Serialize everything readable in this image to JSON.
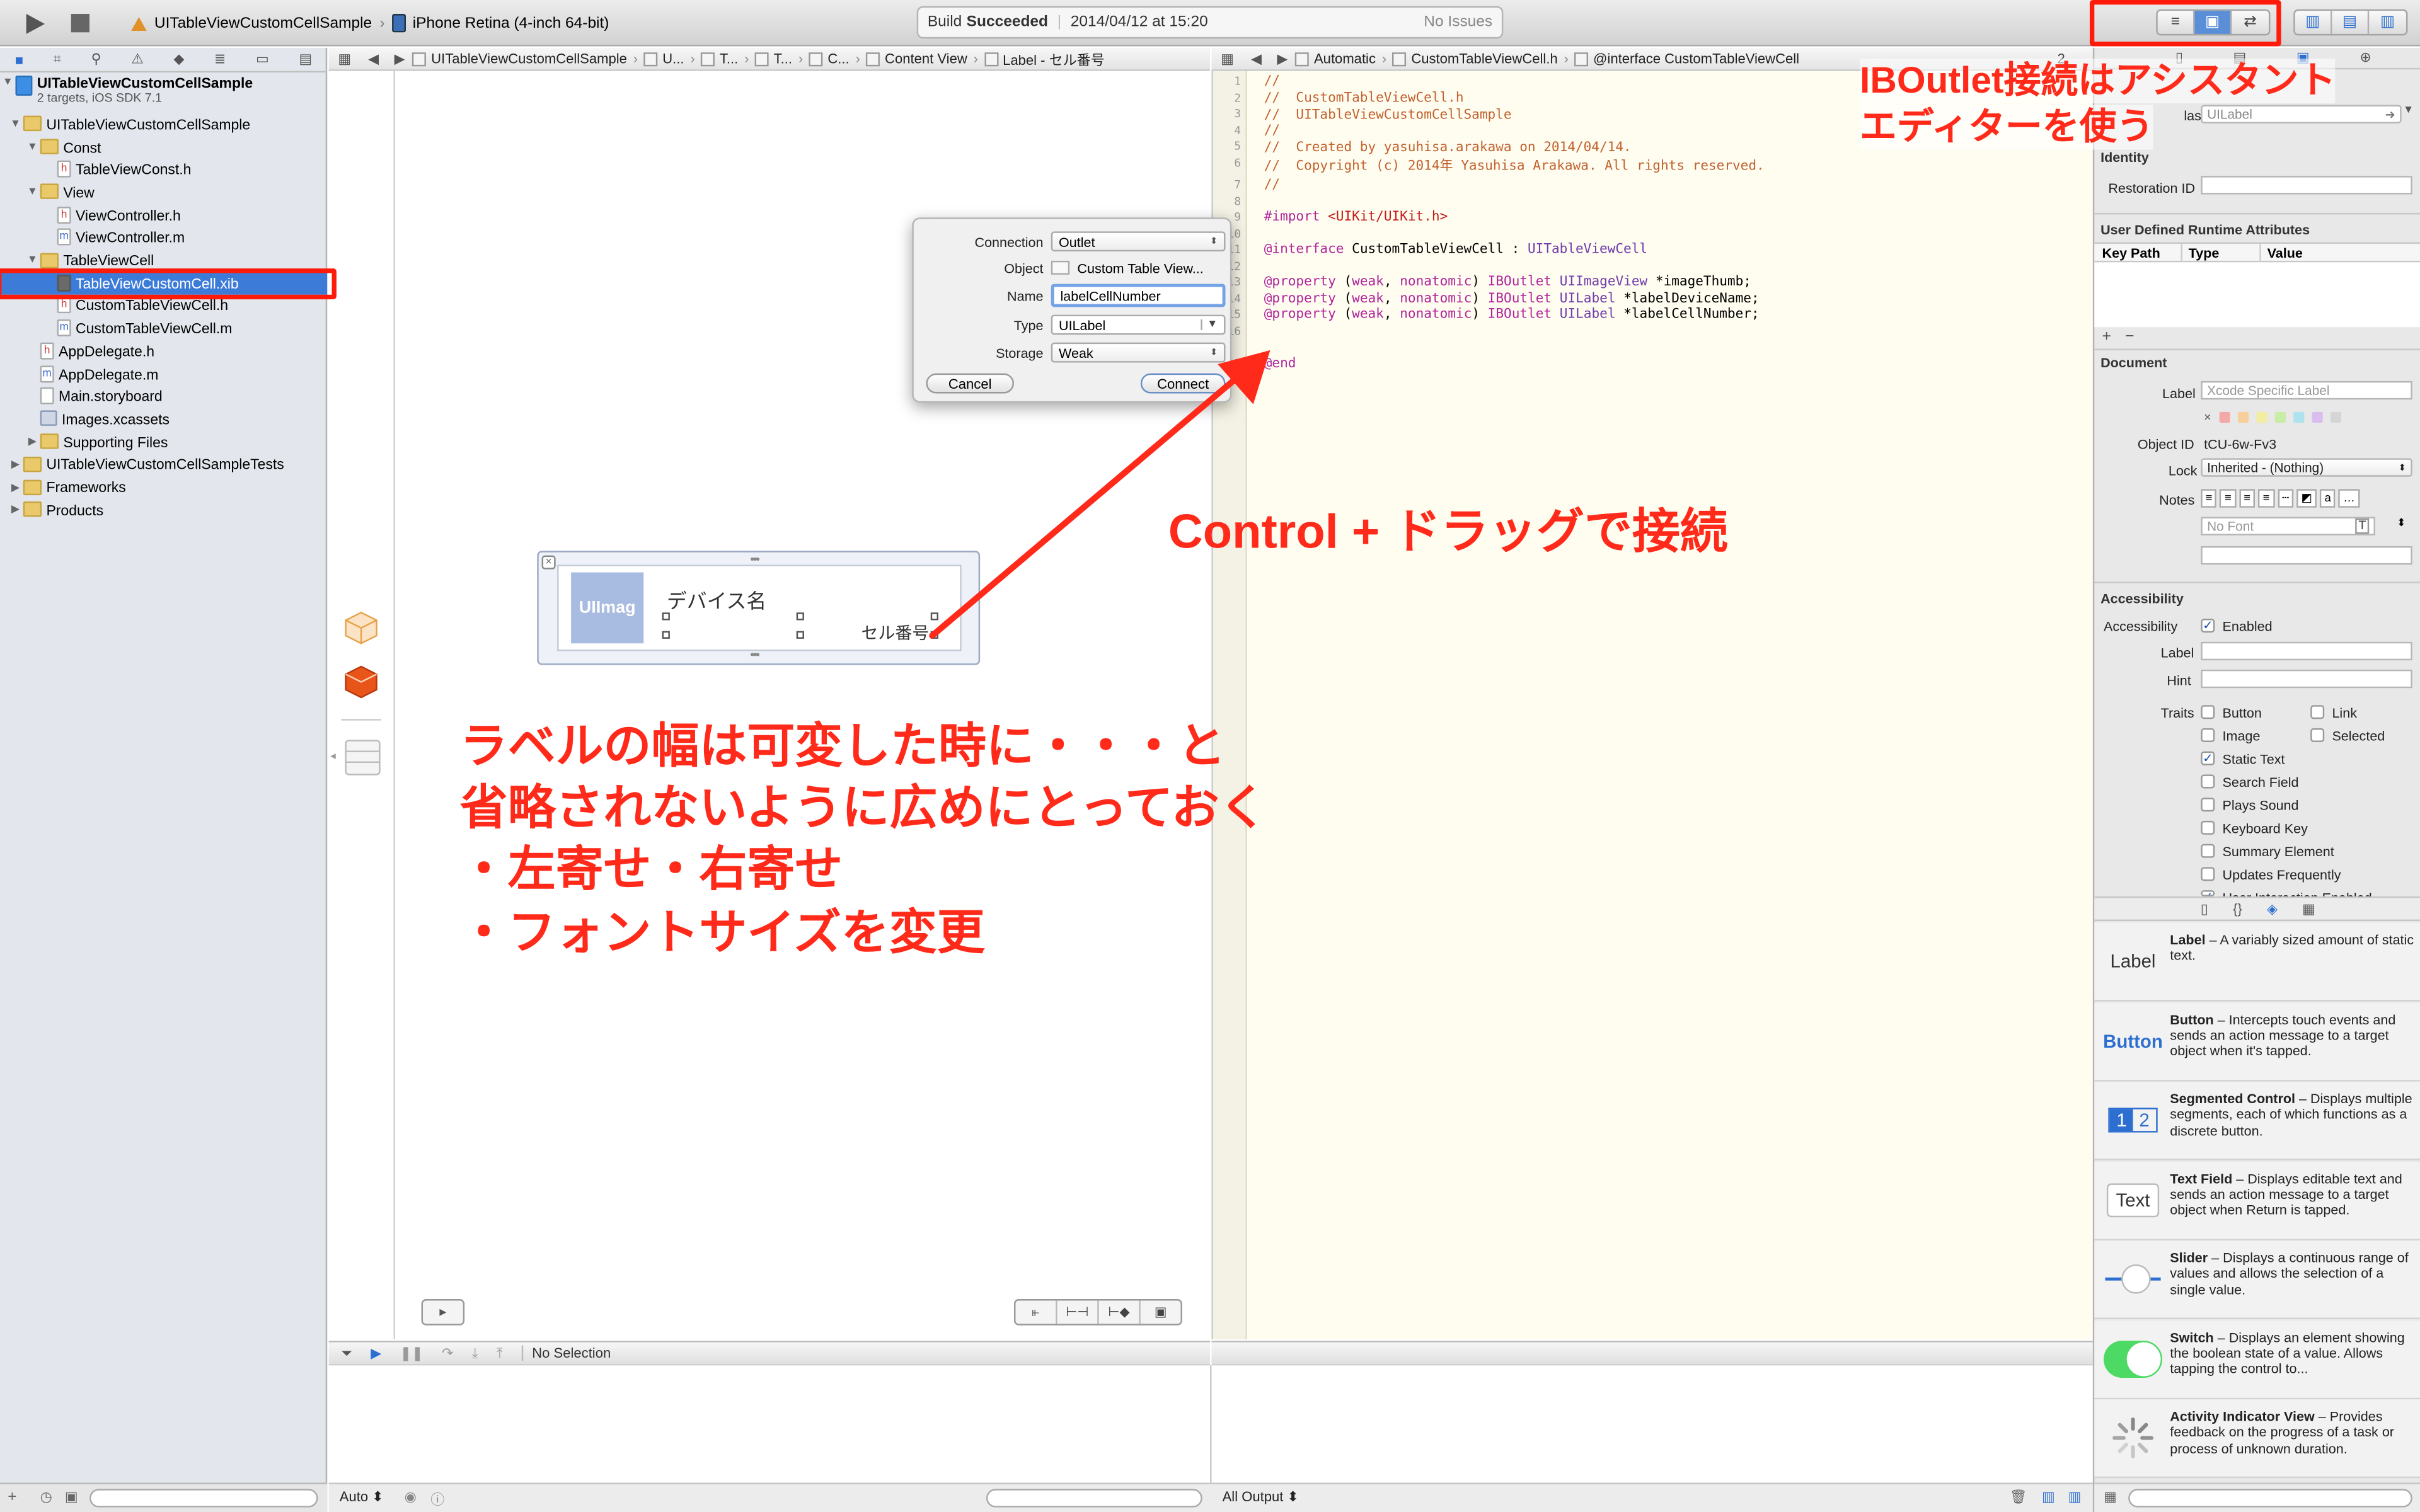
{
  "toolbar": {
    "scheme": "UITableViewCustomCellSample",
    "device": "iPhone Retina (4-inch 64-bit)",
    "status_prefix": "Build",
    "status_word": "Succeeded",
    "status_date": "2014/04/12 at 15:20",
    "issues": "No Issues"
  },
  "navigator": {
    "project_name": "UITableViewCustomCellSample",
    "project_sub": "2 targets, iOS SDK 7.1",
    "items": [
      {
        "label": "UITableViewCustomCellSample",
        "kind": "folder"
      },
      {
        "label": "Const",
        "kind": "folder"
      },
      {
        "label": "TableViewConst.h",
        "kind": "h"
      },
      {
        "label": "View",
        "kind": "folder"
      },
      {
        "label": "ViewController.h",
        "kind": "h"
      },
      {
        "label": "ViewController.m",
        "kind": "m"
      },
      {
        "label": "TableViewCell",
        "kind": "folder"
      },
      {
        "label": "TableViewCustomCell.xib",
        "kind": "xib",
        "selected": true
      },
      {
        "label": "CustomTableViewCell.h",
        "kind": "h"
      },
      {
        "label": "CustomTableViewCell.m",
        "kind": "m"
      },
      {
        "label": "AppDelegate.h",
        "kind": "h"
      },
      {
        "label": "AppDelegate.m",
        "kind": "m"
      },
      {
        "label": "Main.storyboard",
        "kind": "storyboard"
      },
      {
        "label": "Images.xcassets",
        "kind": "assets"
      },
      {
        "label": "Supporting Files",
        "kind": "folder"
      },
      {
        "label": "UITableViewCustomCellSampleTests",
        "kind": "folder"
      },
      {
        "label": "Frameworks",
        "kind": "folder"
      },
      {
        "label": "Products",
        "kind": "folder"
      }
    ]
  },
  "jumpbar_left": [
    "UITableViewCustomCellSample",
    "U...",
    "T...",
    "T...",
    "C...",
    "Content View",
    "Label - セル番号"
  ],
  "jumpbar_right": [
    "Automatic",
    "CustomTableViewCell.h",
    "@interface CustomTableViewCell"
  ],
  "jumpbar_right_count": "2",
  "code": {
    "l1": "//",
    "l2": "//  CustomTableViewCell.h",
    "l3": "//  UITableViewCustomCellSample",
    "l4": "//",
    "l5": "//  Created by yasuhisa.arakawa on 2014/04/14.",
    "l6": "//  Copyright (c) 2014年 Yasuhisa Arakawa. All rights reserved.",
    "l7": "//",
    "import_kw": "#import",
    "import_path": "<UIKit/UIKit.h>",
    "iface_kw": "@interface",
    "iface_name": "CustomTableViewCell :",
    "iface_super": "UITableViewCell",
    "prop1_a": "@property",
    "prop1_b": "(weak, nonatomic)",
    "prop1_c": "IBOutlet",
    "prop1_d": "UIImageView",
    "prop1_e": "*imageThumb;",
    "prop2_a": "@property",
    "prop2_b": "(weak, nonatomic)",
    "prop2_c": "IBOutlet",
    "prop2_d": "UILabel",
    "prop2_e": "*labelDeviceName;",
    "prop3_a": "@property",
    "prop3_b": "(weak, nonatomic)",
    "prop3_c": "IBOutlet",
    "prop3_d": "UILabel",
    "prop3_e": "*labelCellNumber;",
    "end": "@end",
    "line_numbers": [
      "1",
      "2",
      "3",
      "4",
      "5",
      "6",
      "7",
      "8",
      "9",
      "10",
      "11",
      "12",
      "13",
      "14",
      "15",
      "16",
      "17"
    ]
  },
  "cell": {
    "image_label": "UIImag",
    "device_label": "デバイス名",
    "number_label": "セル番号"
  },
  "popup": {
    "connection_label": "Connection",
    "connection_value": "Outlet",
    "object_label": "Object",
    "object_value": "Custom Table View...",
    "name_label": "Name",
    "name_value": "labelCellNumber",
    "type_label": "Type",
    "type_value": "UILabel",
    "storage_label": "Storage",
    "storage_value": "Weak",
    "cancel": "Cancel",
    "connect": "Connect"
  },
  "debug": {
    "selection": "No Selection",
    "auto": "Auto",
    "output": "All Output"
  },
  "inspector": {
    "class_label": "lass",
    "class_value": "UILabel",
    "identity": "Identity",
    "restoration_id": "Restoration ID",
    "udra": "User Defined Runtime Attributes",
    "col_keypath": "Key Path",
    "col_type": "Type",
    "col_value": "Value",
    "document": "Document",
    "label_label": "Label",
    "label_placeholder": "Xcode Specific Label",
    "object_id_label": "Object ID",
    "object_id_value": "tCU-6w-Fv3",
    "lock_label": "Lock",
    "lock_value": "Inherited - (Nothing)",
    "notes_label": "Notes",
    "font_placeholder": "No Font",
    "accessibility": "Accessibility",
    "acc_label": "Accessibility",
    "acc_enabled": "Enabled",
    "acc_label2": "Label",
    "acc_hint": "Hint",
    "traits_label": "Traits",
    "traits": [
      {
        "name": "Button",
        "checked": false
      },
      {
        "name": "Link",
        "checked": false
      },
      {
        "name": "Image",
        "checked": false
      },
      {
        "name": "Selected",
        "checked": false
      },
      {
        "name": "Static Text",
        "checked": true
      },
      {
        "name": "Search Field",
        "checked": false
      },
      {
        "name": "Plays Sound",
        "checked": false
      },
      {
        "name": "Keyboard Key",
        "checked": false
      },
      {
        "name": "Summary Element",
        "checked": false
      },
      {
        "name": "Updates Frequently",
        "checked": false
      },
      {
        "name": "User Interaction Enabled",
        "checked": true
      }
    ]
  },
  "library": [
    {
      "icon": "Label",
      "title": "Label",
      "desc": " – A variably sized amount of static text."
    },
    {
      "icon": "Button",
      "title": "Button",
      "desc": " – Intercepts touch events and sends an action message to a target object when it's tapped."
    },
    {
      "icon": "1 2",
      "title": "Segmented Control",
      "desc": " – Displays multiple segments, each of which functions as a discrete button."
    },
    {
      "icon": "Text",
      "title": "Text Field",
      "desc": " – Displays editable text and sends an action message to a target object when Return is tapped."
    },
    {
      "icon": "slider",
      "title": "Slider",
      "desc": " – Displays a continuous range of values and allows the selection of a single value."
    },
    {
      "icon": "switch",
      "title": "Switch",
      "desc": " – Displays an element showing the boolean state of a value. Allows tapping the control to..."
    },
    {
      "icon": "spinner",
      "title": "Activity Indicator View",
      "desc": " – Provides feedback on the progress of a task or process of unknown duration."
    }
  ],
  "annotations": {
    "assistant_1": "IBOutlet接続はアシスタント",
    "assistant_2": "エディターを使う",
    "drag": "Control + ドラッグで接続",
    "width_1": "ラベルの幅は可変した時に・・・と",
    "width_2": "省略されないように広めにとっておく",
    "width_3": "・左寄せ・右寄せ",
    "width_4": "・フォントサイズを変更"
  },
  "colors": {
    "annotation": "#ff2a1a",
    "selection": "#3d7bd9",
    "comment": "#c26230",
    "keyword": "#b0259d"
  }
}
